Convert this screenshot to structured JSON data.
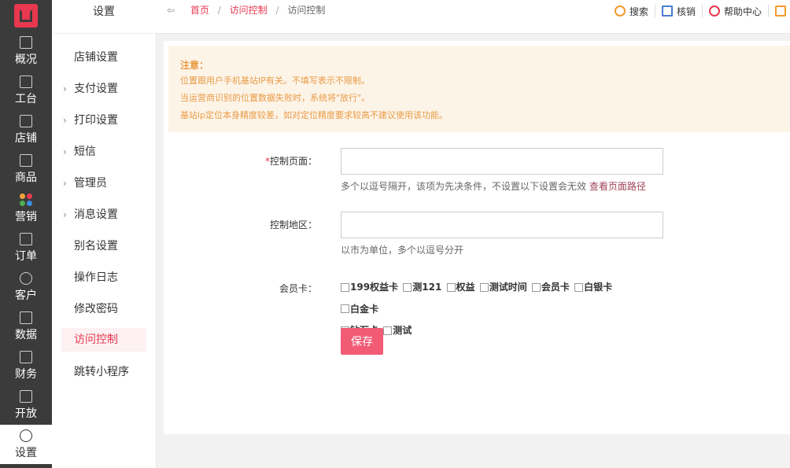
{
  "nav": {
    "items": [
      {
        "label": "概况",
        "icon": "monitor-icon"
      },
      {
        "label": "工台",
        "icon": "desktop-icon"
      },
      {
        "label": "店铺",
        "icon": "store-icon"
      },
      {
        "label": "商品",
        "icon": "bag-icon"
      },
      {
        "label": "营销",
        "icon": "apps-icon"
      },
      {
        "label": "订单",
        "icon": "order-icon"
      },
      {
        "label": "客户",
        "icon": "user-icon"
      },
      {
        "label": "数据",
        "icon": "chart-icon"
      },
      {
        "label": "财务",
        "icon": "wallet-icon"
      },
      {
        "label": "开放",
        "icon": "code-icon"
      },
      {
        "label": "设置",
        "icon": "gear-icon"
      }
    ],
    "active_index": 10
  },
  "sidebar": {
    "title": "设置",
    "items": [
      {
        "label": "店铺设置",
        "arrow": false
      },
      {
        "label": "支付设置",
        "arrow": true
      },
      {
        "label": "打印设置",
        "arrow": true
      },
      {
        "label": "短信",
        "arrow": true
      },
      {
        "label": "管理员",
        "arrow": true
      },
      {
        "label": "消息设置",
        "arrow": true
      },
      {
        "label": "别名设置",
        "arrow": false
      },
      {
        "label": "操作日志",
        "arrow": false
      },
      {
        "label": "修改密码",
        "arrow": false
      },
      {
        "label": "访问控制",
        "arrow": false
      },
      {
        "label": "跳转小程序",
        "arrow": false
      }
    ],
    "active_index": 9
  },
  "breadcrumb": {
    "back": "⇦",
    "home": "首页",
    "parent": "访问控制",
    "current": "访问控制",
    "sep": "/"
  },
  "toolbar": {
    "search": "搜索",
    "verify": "核销",
    "help": "帮助中心"
  },
  "notice": {
    "title": "注意：",
    "lines": [
      "位置跟用户手机基站IP有关。不填写表示不限制。",
      "当运营商识别的位置数据失败时，系统将\"放行\"。",
      "基站ip定位本身精度较差，如对定位精度要求较高不建议使用该功能。"
    ]
  },
  "form": {
    "page_label_req": "*",
    "page_label": "控制页面：",
    "page_value": "",
    "page_hint": "多个以逗号隔开，该项为先决条件，不设置以下设置会无效",
    "page_hint_link": "查看页面路径",
    "area_label": "控制地区：",
    "area_value": "",
    "area_hint": "以市为单位，多个以逗号分开",
    "card_label": "会员卡：",
    "cards": [
      "199权益卡",
      "测121",
      "权益",
      "测试时间",
      "会员卡",
      "白银卡",
      "白金卡",
      "钻石卡",
      "测试"
    ],
    "save": "保存"
  },
  "colors": {
    "accent": "#e8384f",
    "save_button": "#f25b74",
    "notice_bg": "#fdf4e8",
    "notice_text": "#e89b45",
    "nav_bg": "#3b3b3b"
  }
}
